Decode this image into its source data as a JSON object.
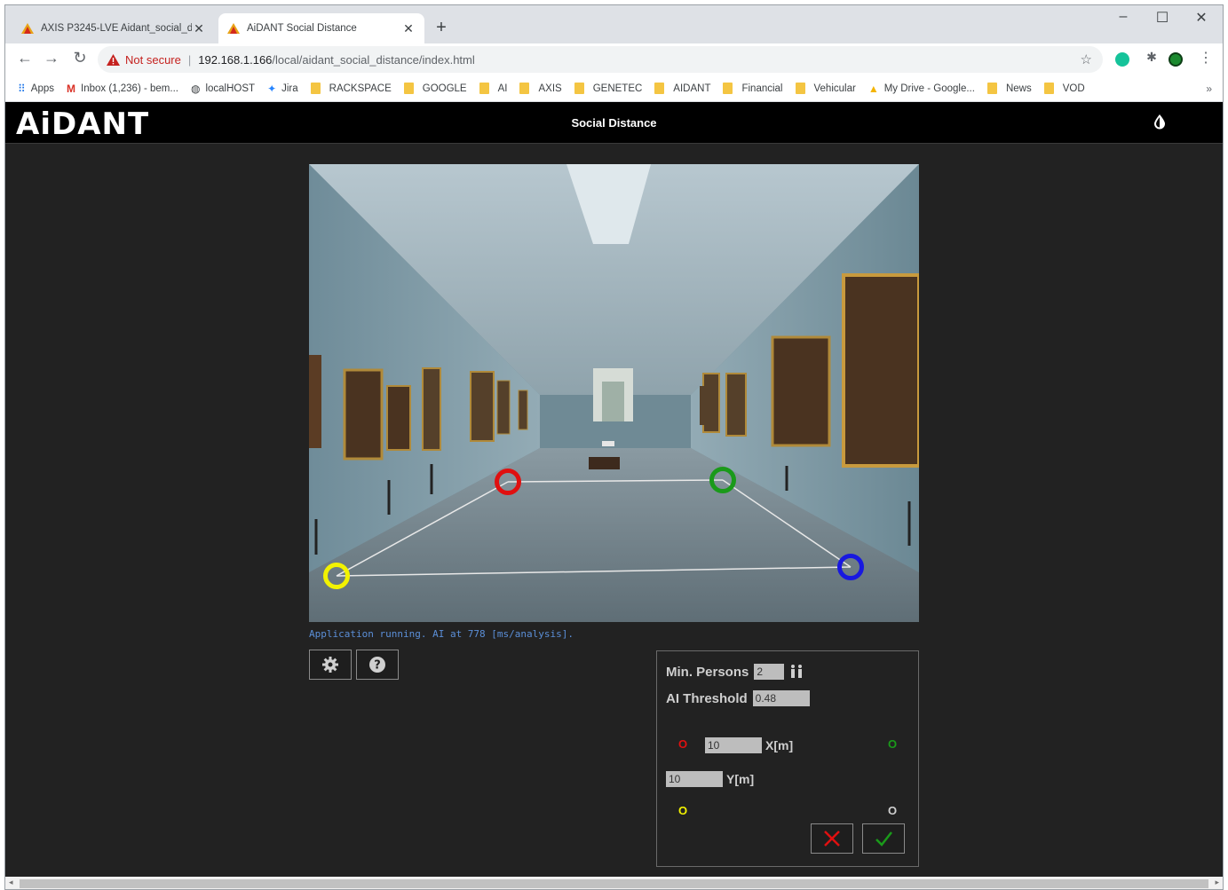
{
  "browser": {
    "tabs": [
      {
        "title": "AXIS P3245-LVE Aidant_social_di",
        "active": false
      },
      {
        "title": "AiDANT Social Distance",
        "active": true
      }
    ],
    "address": {
      "security_label": "Not secure",
      "separator": "|",
      "host": "192.168.1.166",
      "path": "/local/aidant_social_distance/index.html"
    },
    "bookmarks": [
      {
        "label": "Apps",
        "icon": "apps-grid-icon"
      },
      {
        "label": "Inbox (1,236) - bem...",
        "icon": "gmail-icon"
      },
      {
        "label": "localHOST",
        "icon": "globe-icon"
      },
      {
        "label": "Jira",
        "icon": "jira-icon"
      },
      {
        "label": "RACKSPACE",
        "icon": "folder-icon"
      },
      {
        "label": "GOOGLE",
        "icon": "folder-icon"
      },
      {
        "label": "AI",
        "icon": "folder-icon"
      },
      {
        "label": "AXIS",
        "icon": "folder-icon"
      },
      {
        "label": "GENETEC",
        "icon": "folder-icon"
      },
      {
        "label": "AIDANT",
        "icon": "folder-icon"
      },
      {
        "label": "Financial",
        "icon": "folder-icon"
      },
      {
        "label": "Vehicular",
        "icon": "folder-icon"
      },
      {
        "label": "My Drive - Google...",
        "icon": "google-drive-icon"
      },
      {
        "label": "News",
        "icon": "folder-icon"
      },
      {
        "label": "VOD",
        "icon": "folder-icon"
      }
    ],
    "bookmarks_overflow": "»"
  },
  "app": {
    "logo": "AiDANT",
    "title": "Social Distance",
    "status": "Application running. AI at 778 [ms/analysis].",
    "calibration_markers": [
      {
        "name": "red",
        "color": "#e01010"
      },
      {
        "name": "green",
        "color": "#1a9a1a"
      },
      {
        "name": "blue",
        "color": "#1818e0"
      },
      {
        "name": "yellow",
        "color": "#f2f200"
      }
    ],
    "panel": {
      "min_persons_label": "Min. Persons",
      "min_persons_value": "2",
      "ai_threshold_label": "AI Threshold",
      "ai_threshold_value": "0.48",
      "x_value": "10",
      "x_unit": "X[m]",
      "y_value": "10",
      "y_unit": "Y[m]",
      "corner_symbol": "O",
      "corner_colors": {
        "red": "#e01010",
        "green": "#1a9a1a",
        "yellow": "#f2f200",
        "white": "#cfcfcf"
      }
    }
  },
  "colors": {
    "app_bg": "#222222",
    "header_bg": "#000000",
    "status_text": "#5b8fd8",
    "cancel": "#e01010",
    "confirm": "#1a9a1a"
  }
}
